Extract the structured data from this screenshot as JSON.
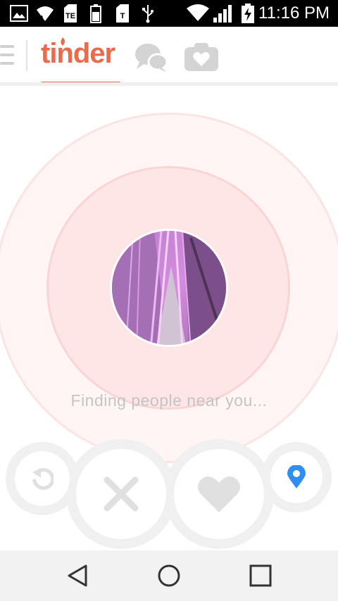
{
  "status_bar": {
    "time": "11:16 PM",
    "icons": [
      "gallery-icon",
      "wifi-call-icon",
      "sim-icon",
      "battery-small-icon",
      "sim-icon",
      "usb-icon",
      "wifi-icon",
      "signal-icon",
      "battery-charging-icon"
    ]
  },
  "header": {
    "logo_text": "tinder",
    "active_tab": "tinder",
    "accent_color": "#ea6a4a",
    "icons": [
      "menu-icon",
      "chat-icon",
      "moments-icon"
    ]
  },
  "main": {
    "finding_text": "Finding people near you...",
    "radar_colors": {
      "outer": "#fff5f5",
      "inner": "#ffe6e6"
    }
  },
  "actions": [
    {
      "name": "rewind",
      "icon": "rewind-icon",
      "color": "#e0e0e0"
    },
    {
      "name": "nope",
      "icon": "close-icon",
      "color": "#e0e0e0"
    },
    {
      "name": "like",
      "icon": "heart-icon",
      "color": "#e0e0e0"
    },
    {
      "name": "location",
      "icon": "location-pin-icon",
      "color": "#2f8ff0"
    }
  ],
  "nav_bar": {
    "buttons": [
      "back-icon",
      "home-icon",
      "recents-icon"
    ]
  }
}
